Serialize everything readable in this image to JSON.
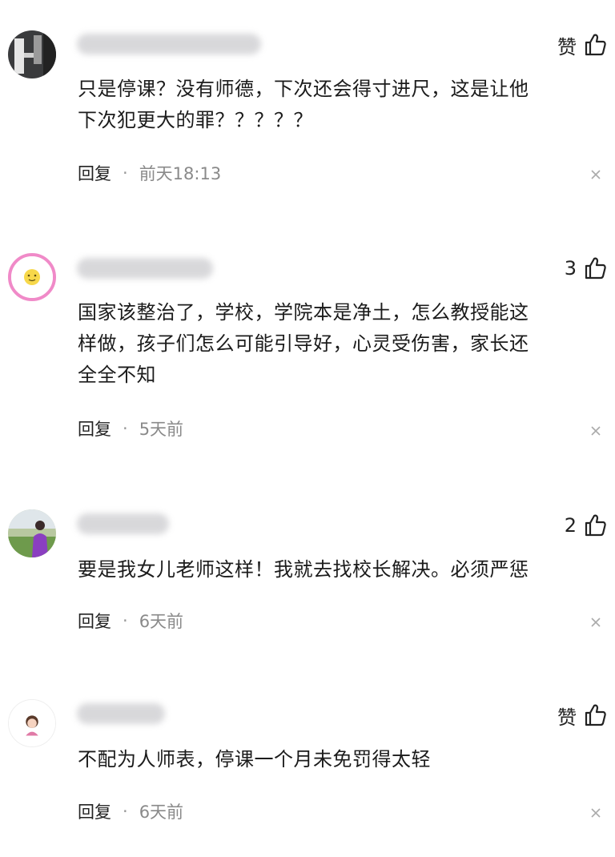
{
  "comments": [
    {
      "like_label": "赞",
      "text_lines": [
        "只是停课？没有师德，下次还会得寸进尺，这是让他",
        "下次犯更大的罪？？？？？"
      ],
      "reply_label": "回复",
      "separator": "·",
      "time": "前天18:13",
      "avatar_icon": "dark-building-avatar-icon"
    },
    {
      "like_label": "3",
      "text_lines": [
        "国家该整治了，学校，学院本是净土，怎么教授能这",
        "样做，孩子们怎么可能引导好，心灵受伤害，家长还",
        "全全不知"
      ],
      "reply_label": "回复",
      "separator": "·",
      "time": "5天前",
      "avatar_icon": "fried-egg-avatar-icon"
    },
    {
      "like_label": "2",
      "text_lines": [
        "要是我女儿老师这样！我就去找校长解决。必须严惩"
      ],
      "reply_label": "回复",
      "separator": "·",
      "time": "6天前",
      "avatar_icon": "person-landscape-avatar-icon"
    },
    {
      "like_label": "赞",
      "text_lines": [
        "不配为人师表，停课一个月未免罚得太轻"
      ],
      "reply_label": "回复",
      "separator": "·",
      "time": "6天前",
      "avatar_icon": "cartoon-girl-avatar-icon"
    }
  ],
  "colors": {
    "text": "#1b1b1b",
    "meta": "#8a8a8a",
    "avatar_ring_pink": "#f08ac8"
  }
}
